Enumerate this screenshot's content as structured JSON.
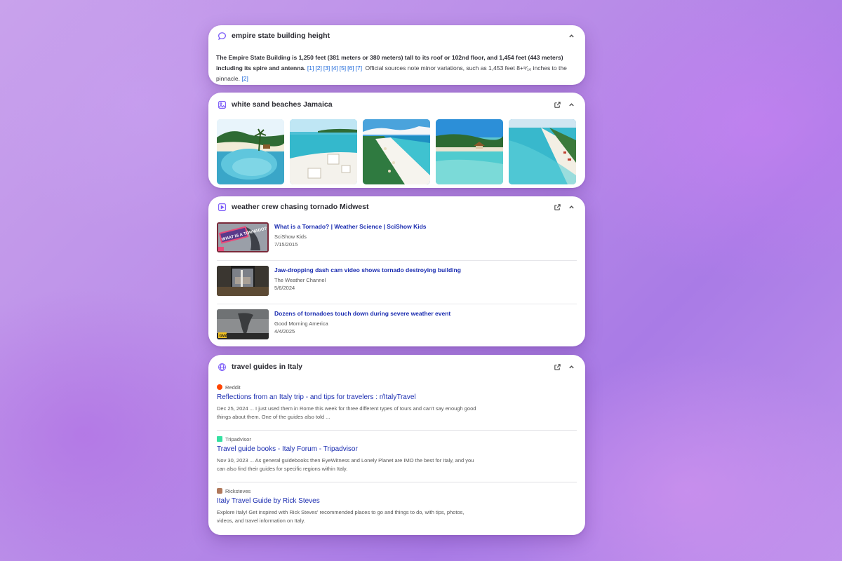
{
  "card_text": {
    "query": "empire state building height",
    "answer_bold": "The Empire State Building is 1,250 feet (381 meters or 380 meters) tall to its roof or 102nd floor, and 1,454 feet (443 meters) including its spire and antenna.",
    "citations_1": [
      "[1]",
      "[2]",
      "[3]",
      "[4]",
      "[5]",
      "[6]",
      "[7]"
    ],
    "answer_rest": "Official sources note minor variations, such as 1,453 feet 8+⁹⁄₁₆ inches to the pinnacle.",
    "citations_2": [
      "[2]"
    ]
  },
  "card_images": {
    "query": "white sand beaches Jamaica",
    "images": [
      {
        "name": "beach-image-1"
      },
      {
        "name": "beach-image-2"
      },
      {
        "name": "beach-image-3"
      },
      {
        "name": "beach-image-4"
      },
      {
        "name": "beach-image-5"
      }
    ]
  },
  "card_videos": {
    "query": "weather crew chasing tornado Midwest",
    "videos": [
      {
        "title": "What is a Tornado? | Weather Science | SciShow Kids",
        "channel": "SciShow Kids",
        "date": "7/15/2015",
        "thumb_text": "WHAT IS A TORNADO?"
      },
      {
        "title": "Jaw-dropping dash cam video shows tornado destroying building",
        "channel": "The Weather Channel",
        "date": "5/6/2024"
      },
      {
        "title": "Dozens of tornadoes touch down during severe weather event",
        "channel": "Good Morning America",
        "date": "4/4/2025",
        "thumb_text": "GMA"
      }
    ]
  },
  "card_web": {
    "query": "travel guides in Italy",
    "results": [
      {
        "source": "Reddit",
        "favicon_color": "#ff4500",
        "title": "Reflections from an Italy trip - and tips for travelers : r/ItalyTravel",
        "snippet": "Dec 25, 2024 ... I just used them in Rome this week for three different types of tours and can't say enough good things about them. One of the guides also told ..."
      },
      {
        "source": "Tripadvisor",
        "favicon_color": "#34e0a1",
        "title": "Travel guide books - Italy Forum - Tripadvisor",
        "snippet": "Nov 30, 2023 ... As general guidebooks then EyeWitness and Lonely Planet are IMO the best for Italy, and you can also find their guides for specific regions within Italy."
      },
      {
        "source": "Ricksteves",
        "favicon_color": "#b0785a",
        "title": "Italy Travel Guide by Rick Steves",
        "snippet": "Explore Italy! Get inspired with Rick Steves' recommended places to go and things to do, with tips, photos, videos, and travel information on Italy."
      }
    ]
  },
  "colors": {
    "accent": "#7a5af8",
    "link": "#1a2cb0",
    "citation": "#1a66d9"
  },
  "icons": {
    "text_card": "chat-bubble-icon",
    "image_card": "image-icon",
    "video_card": "video-play-icon",
    "web_card": "globe-icon",
    "external": "external-link-icon",
    "collapse": "chevron-up-icon"
  }
}
